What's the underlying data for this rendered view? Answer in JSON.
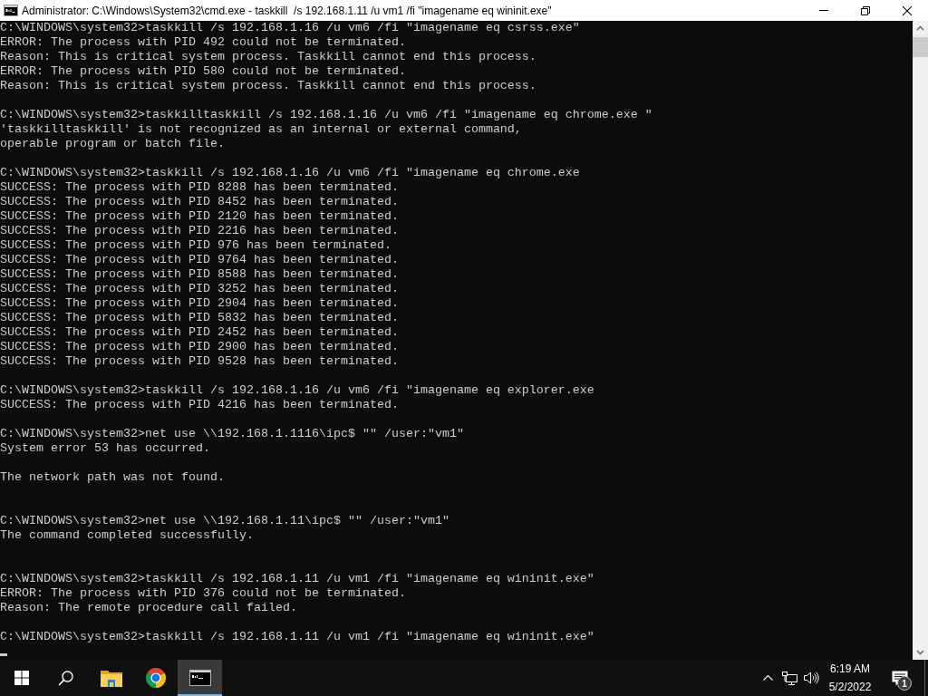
{
  "window": {
    "title": "Administrator: C:\\Windows\\System32\\cmd.exe - taskkill  /s 192.168.1.11 /u vm1 /fi \"imagename eq wininit.exe\""
  },
  "console": {
    "lines": [
      {
        "kind": "text",
        "text": "C:\\WINDOWS\\system32>taskkill /s 192.168.1.16 /u vm6 /fi \"imagename eq csrss.exe\""
      },
      {
        "kind": "text",
        "text": "ERROR: The process with PID 492 could not be terminated."
      },
      {
        "kind": "text",
        "text": "Reason: This is critical system process. Taskkill cannot end this process."
      },
      {
        "kind": "text",
        "text": "ERROR: The process with PID 580 could not be terminated."
      },
      {
        "kind": "text",
        "text": "Reason: This is critical system process. Taskkill cannot end this process."
      },
      {
        "kind": "blank"
      },
      {
        "kind": "text",
        "text": "C:\\WINDOWS\\system32>taskkilltaskkill /s 192.168.1.16 /u vm6 /fi \"imagename eq chrome.exe \""
      },
      {
        "kind": "text",
        "text": "'taskkilltaskkill' is not recognized as an internal or external command,"
      },
      {
        "kind": "text",
        "text": "operable program or batch file."
      },
      {
        "kind": "blank"
      },
      {
        "kind": "text",
        "text": "C:\\WINDOWS\\system32>taskkill /s 192.168.1.16 /u vm6 /fi \"imagename eq chrome.exe"
      },
      {
        "kind": "text",
        "text": "SUCCESS: The process with PID 8288 has been terminated."
      },
      {
        "kind": "text",
        "text": "SUCCESS: The process with PID 8452 has been terminated."
      },
      {
        "kind": "text",
        "text": "SUCCESS: The process with PID 2120 has been terminated."
      },
      {
        "kind": "text",
        "text": "SUCCESS: The process with PID 2216 has been terminated."
      },
      {
        "kind": "text",
        "text": "SUCCESS: The process with PID 976 has been terminated."
      },
      {
        "kind": "text",
        "text": "SUCCESS: The process with PID 9764 has been terminated."
      },
      {
        "kind": "text",
        "text": "SUCCESS: The process with PID 8588 has been terminated."
      },
      {
        "kind": "text",
        "text": "SUCCESS: The process with PID 3252 has been terminated."
      },
      {
        "kind": "text",
        "text": "SUCCESS: The process with PID 2904 has been terminated."
      },
      {
        "kind": "text",
        "text": "SUCCESS: The process with PID 5832 has been terminated."
      },
      {
        "kind": "text",
        "text": "SUCCESS: The process with PID 2452 has been terminated."
      },
      {
        "kind": "text",
        "text": "SUCCESS: The process with PID 2900 has been terminated."
      },
      {
        "kind": "text",
        "text": "SUCCESS: The process with PID 9528 has been terminated."
      },
      {
        "kind": "blank"
      },
      {
        "kind": "text",
        "text": "C:\\WINDOWS\\system32>taskkill /s 192.168.1.16 /u vm6 /fi \"imagename eq explorer.exe"
      },
      {
        "kind": "text",
        "text": "SUCCESS: The process with PID 4216 has been terminated."
      },
      {
        "kind": "blank"
      },
      {
        "kind": "text",
        "text": "C:\\WINDOWS\\system32>net use \\\\192.168.1.1116\\ipc$ \"\" /user:\"vm1\""
      },
      {
        "kind": "text",
        "text": "System error 53 has occurred."
      },
      {
        "kind": "blank"
      },
      {
        "kind": "text",
        "text": "The network path was not found."
      },
      {
        "kind": "blank"
      },
      {
        "kind": "blank"
      },
      {
        "kind": "text",
        "text": "C:\\WINDOWS\\system32>net use \\\\192.168.1.11\\ipc$ \"\" /user:\"vm1\""
      },
      {
        "kind": "text",
        "text": "The command completed successfully."
      },
      {
        "kind": "blank"
      },
      {
        "kind": "blank"
      },
      {
        "kind": "text",
        "text": "C:\\WINDOWS\\system32>taskkill /s 192.168.1.11 /u vm1 /fi \"imagename eq wininit.exe\""
      },
      {
        "kind": "text",
        "text": "ERROR: The process with PID 376 could not be terminated."
      },
      {
        "kind": "text",
        "text": "Reason: The remote procedure call failed."
      },
      {
        "kind": "blank"
      },
      {
        "kind": "text",
        "text": "C:\\WINDOWS\\system32>taskkill /s 192.168.1.11 /u vm1 /fi \"imagename eq wininit.exe\""
      },
      {
        "kind": "cursor"
      }
    ]
  },
  "taskbar": {
    "apps": [
      {
        "kind": "folder",
        "selected": false
      },
      {
        "kind": "browser",
        "selected": false
      },
      {
        "kind": "terminal",
        "selected": true
      }
    ],
    "clock": {
      "time": "6:19 AM",
      "date": "5/2/2022"
    },
    "notifications": {
      "count": "1"
    }
  }
}
